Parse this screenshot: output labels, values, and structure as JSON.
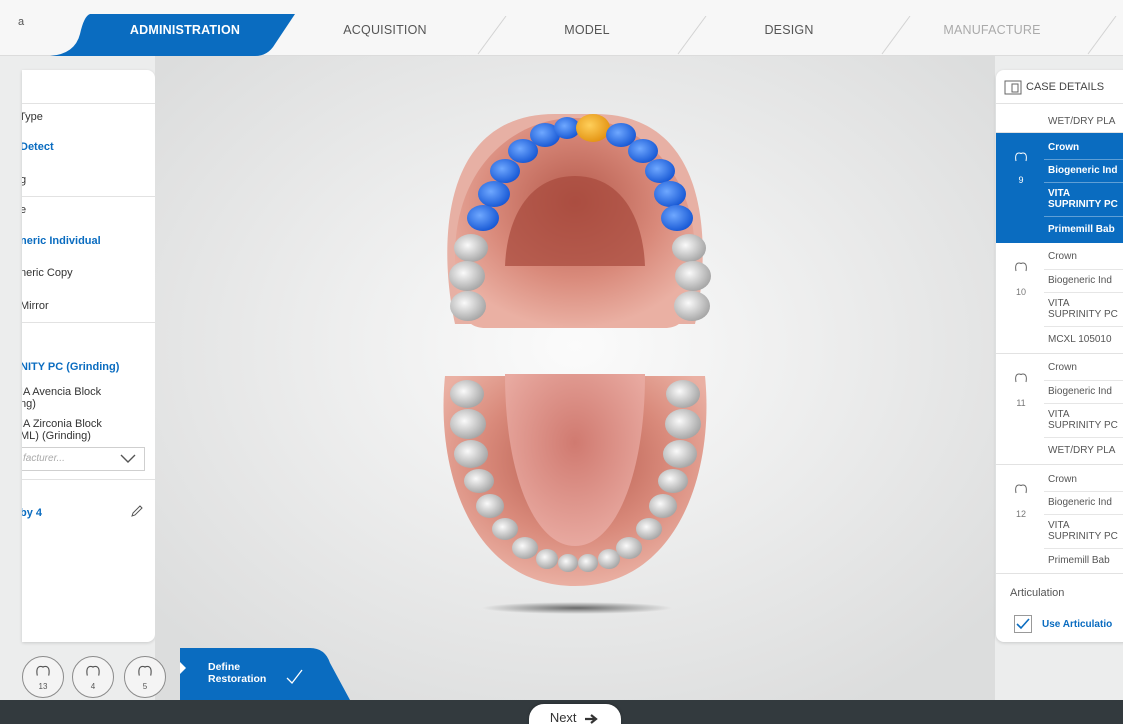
{
  "topbar": {
    "left_label": "a",
    "steps": [
      {
        "label": "ADMINISTRATION",
        "state": "active"
      },
      {
        "label": "ACQUISITION",
        "state": "normal"
      },
      {
        "label": "MODEL",
        "state": "normal"
      },
      {
        "label": "DESIGN",
        "state": "normal"
      },
      {
        "label": "MANUFACTURE",
        "state": "disabled"
      }
    ],
    "accent_color": "#0a6cc0"
  },
  "left_panel": {
    "type_heading": "Type",
    "type_options": [
      "Detect",
      "g"
    ],
    "method_heading": "e",
    "method_options": [
      "neric Individual",
      "neric Copy",
      "Mirror"
    ],
    "material_options": [
      "NITY PC (Grinding)",
      "IA Avencia Block",
      "ng)",
      "IA Zirconia Block",
      "ML) (Grinding)"
    ],
    "manufacturer_placeholder": "facturer...",
    "machine_label": "by 4"
  },
  "case_details": {
    "title": "CASE DETAILS",
    "top_row": "WET/DRY PLA",
    "teeth": [
      {
        "number": "9",
        "type": "Crown",
        "design": "Biogeneric Ind",
        "material_1": "VITA",
        "material_2": "SUPRINITY PC",
        "block": "Primemill Bab",
        "selected": true
      },
      {
        "number": "10",
        "type": "Crown",
        "design": "Biogeneric Ind",
        "material_1": "VITA",
        "material_2": "SUPRINITY PC",
        "block": "MCXL 105010",
        "selected": false
      },
      {
        "number": "11",
        "type": "Crown",
        "design": "Biogeneric Ind",
        "material_1": "VITA",
        "material_2": "SUPRINITY PC",
        "block": "WET/DRY PLA",
        "selected": false
      },
      {
        "number": "12",
        "type": "Crown",
        "design": "Biogeneric Ind",
        "material_1": "VITA",
        "material_2": "SUPRINITY PC",
        "block": "Primemill Bab",
        "selected": false
      }
    ],
    "articulation_label": "Articulation",
    "use_articulation_label": "Use Articulatio"
  },
  "bottom": {
    "tooth_circles": [
      "13",
      "4",
      "5"
    ],
    "define_label_1": "Define",
    "define_label_2": "Restoration",
    "next_label": "Next"
  }
}
